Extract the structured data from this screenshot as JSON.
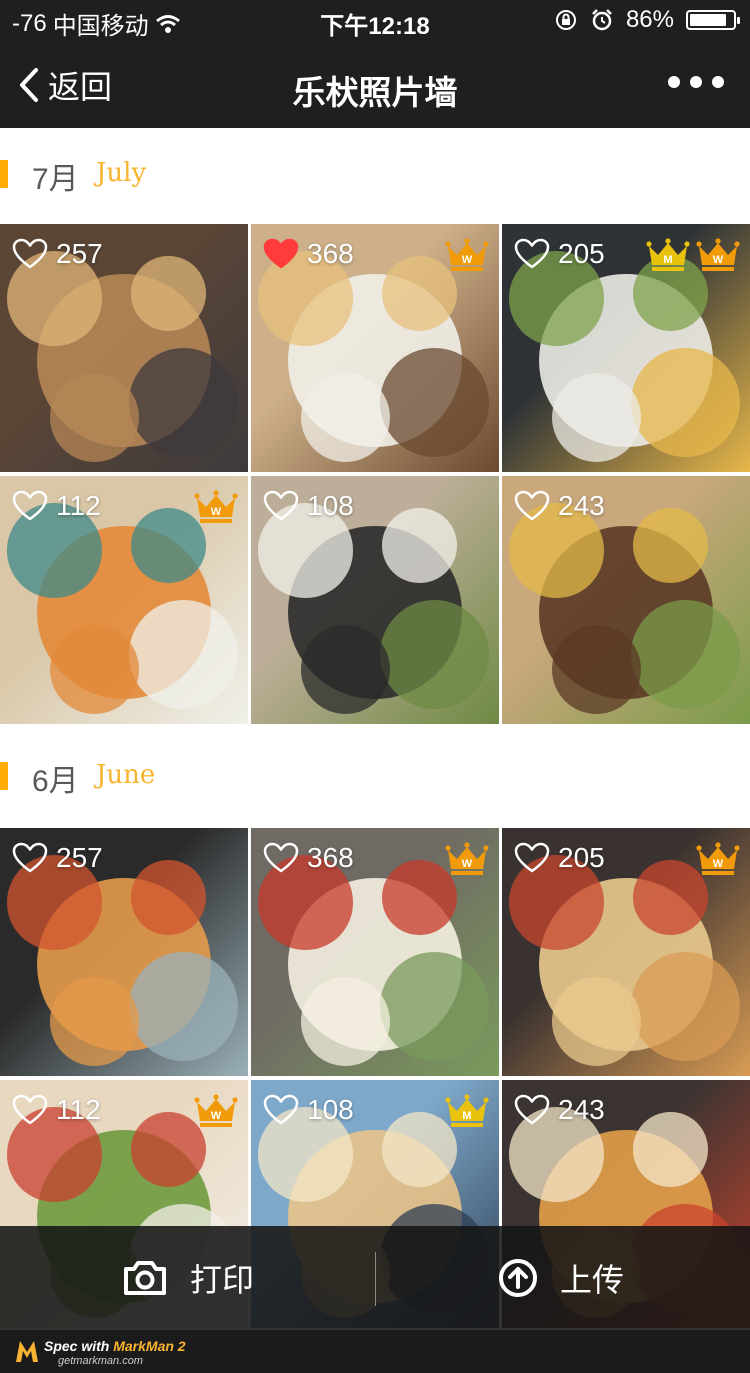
{
  "status": {
    "signal": "-76",
    "carrier": "中国移动",
    "time": "下午12:18",
    "battery": "86%",
    "battery_level": 0.86
  },
  "nav": {
    "back_label": "返回",
    "title": "乐枤照片墙"
  },
  "sections": [
    {
      "month_cn": "7月",
      "month_en": "July",
      "photos": [
        {
          "likes": "257",
          "liked": false,
          "crowns": []
        },
        {
          "likes": "368",
          "liked": true,
          "crowns": [
            "W"
          ]
        },
        {
          "likes": "205",
          "liked": false,
          "crowns": [
            "M",
            "W"
          ]
        },
        {
          "likes": "112",
          "liked": false,
          "crowns": [
            "W"
          ]
        },
        {
          "likes": "108",
          "liked": false,
          "crowns": []
        },
        {
          "likes": "243",
          "liked": false,
          "crowns": []
        }
      ]
    },
    {
      "month_cn": "6月",
      "month_en": "June",
      "photos": [
        {
          "likes": "257",
          "liked": false,
          "crowns": []
        },
        {
          "likes": "368",
          "liked": false,
          "crowns": [
            "W"
          ]
        },
        {
          "likes": "205",
          "liked": false,
          "crowns": [
            "W"
          ]
        },
        {
          "likes": "112",
          "liked": false,
          "crowns": [
            "W"
          ]
        },
        {
          "likes": "108",
          "liked": false,
          "crowns": [
            "M"
          ]
        },
        {
          "likes": "243",
          "liked": false,
          "crowns": []
        }
      ]
    }
  ],
  "bottom": {
    "print_label": "打印",
    "upload_label": "上传"
  },
  "footer": {
    "brand_prefix": "Spec with ",
    "brand_name": "MarkMan 2",
    "url": "getmarkman.com"
  },
  "colors": {
    "accent": "#ffac06",
    "month_cn": "#595959",
    "month_en": "#f8b430",
    "heart_liked": "#ff3b3b",
    "crown_w": "#f29b0a",
    "crown_m": "#e8c20c"
  },
  "icons": {
    "back": "chevron-left-icon",
    "more": "more-dots-icon",
    "like": "heart-icon",
    "crown": "crown-icon",
    "print": "camera-icon",
    "upload": "arrow-up-circle-icon"
  }
}
